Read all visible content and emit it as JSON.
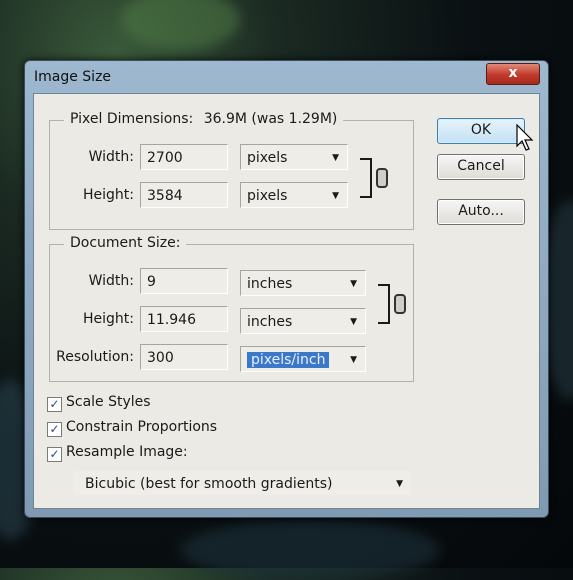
{
  "window": {
    "title": "Image Size",
    "close_label": "x"
  },
  "pixel_dimensions": {
    "title": "Pixel Dimensions:",
    "summary": "36.9M (was 1.29M)",
    "width_label": "Width:",
    "width_value": "2700",
    "width_unit": "pixels",
    "height_label": "Height:",
    "height_value": "3584",
    "height_unit": "pixels"
  },
  "document_size": {
    "title": "Document Size:",
    "width_label": "Width:",
    "width_value": "9",
    "width_unit": "inches",
    "height_label": "Height:",
    "height_value": "11.946",
    "height_unit": "inches",
    "resolution_label": "Resolution:",
    "resolution_value": "300",
    "resolution_unit": "pixels/inch"
  },
  "buttons": {
    "ok": "OK",
    "cancel": "Cancel",
    "auto": "Auto..."
  },
  "options": {
    "scale_styles": "Scale Styles",
    "constrain_proportions": "Constrain Proportions",
    "resample_image": "Resample Image:",
    "resample_method": "Bicubic (best for smooth gradients)"
  },
  "icons": {
    "close": "close-icon",
    "link": "link-icon",
    "dropdown": "chevron-down-icon",
    "check": "checkmark-icon",
    "cursor": "mouse-pointer-icon"
  },
  "colors": {
    "selection_highlight": "#3b78c8",
    "close_button": "#c0392b",
    "default_button": "#c4e1f4"
  }
}
